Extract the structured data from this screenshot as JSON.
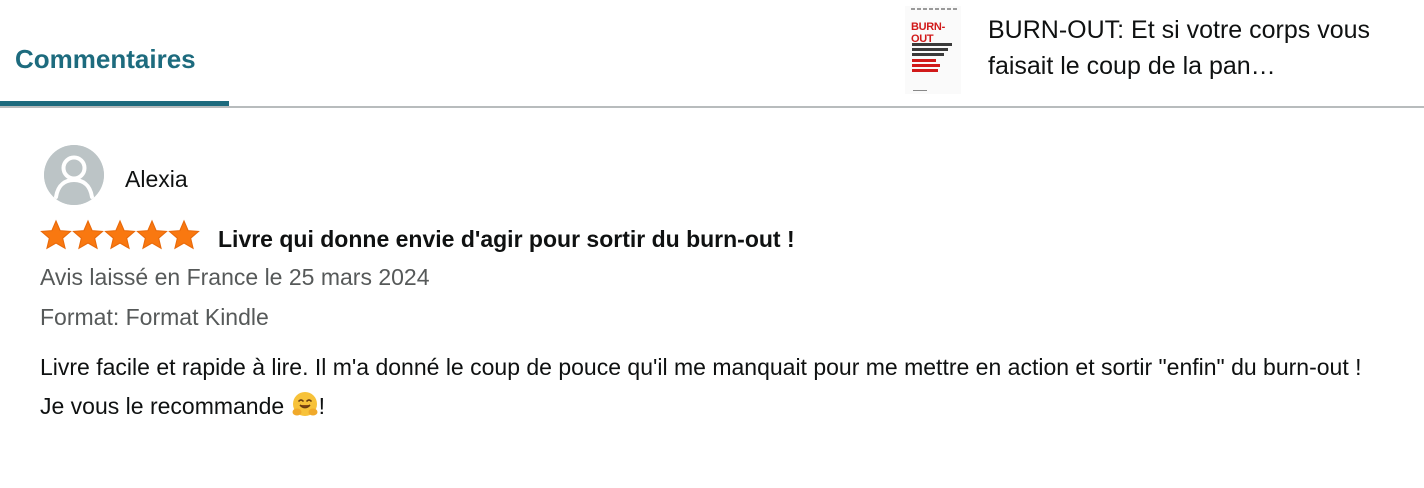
{
  "tabs": {
    "active_label": "Commentaires",
    "accent_color": "#1d6b7e"
  },
  "product": {
    "title": "BURN-OUT: Et si votre corps vous faisait le coup de la pan…",
    "cover_text": "BURN-OUT",
    "cover_icon": "book-cover-image"
  },
  "review": {
    "reviewer_name": "Alexia",
    "avatar_icon": "default-user-avatar-icon",
    "rating": 5,
    "rating_max": 5,
    "star_color": "#f97810",
    "title": "Livre qui donne envie d'agir pour sortir du burn-out !",
    "date_text": "Avis laissé en France le 25 mars 2024",
    "format_text": "Format: Format Kindle",
    "body_line1": "Livre facile et rapide à lire. Il m'a donné le coup de pouce qu'il me manquait pour me mettre en action et sortir \"enfin\" du burn-out !",
    "body_line2_text": "Je vous le recommande ",
    "body_emoji": "hugging-face-emoji",
    "body_line2_end": "!"
  }
}
